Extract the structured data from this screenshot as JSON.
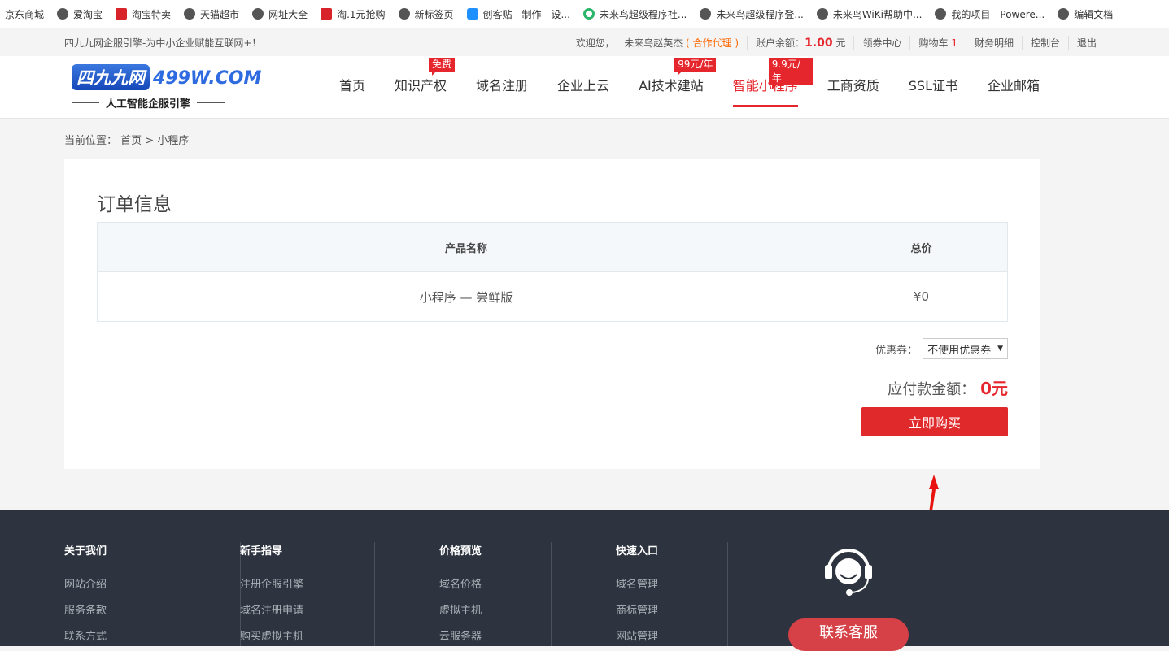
{
  "bookmarks": [
    {
      "label": "京东商城",
      "icon": "none"
    },
    {
      "label": "爱淘宝",
      "icon": "globe"
    },
    {
      "label": "淘宝特卖",
      "icon": "taobao"
    },
    {
      "label": "天猫超市",
      "icon": "globe"
    },
    {
      "label": "网址大全",
      "icon": "globe"
    },
    {
      "label": "淘.1元抢购",
      "icon": "taobao"
    },
    {
      "label": "新标签页",
      "icon": "globe"
    },
    {
      "label": "创客贴 - 制作 - 设...",
      "icon": "chuangke"
    },
    {
      "label": "未来鸟超级程序社...",
      "icon": "green"
    },
    {
      "label": "未来鸟超级程序登...",
      "icon": "globe"
    },
    {
      "label": "未来鸟WiKi帮助中...",
      "icon": "globe"
    },
    {
      "label": "我的项目 - Powere...",
      "icon": "globe"
    },
    {
      "label": "编辑文档",
      "icon": "globe"
    }
  ],
  "topbar": {
    "slogan": "四九九网企服引擎-为中小企业赋能互联网+！",
    "welcome": "欢迎您，",
    "user": "未来鸟赵英杰",
    "role": "( 合作代理 )",
    "balance_label": "账户余额：",
    "balance": "1.00",
    "balance_unit": "元",
    "links": [
      "领券中心",
      "购物车",
      "财务明细",
      "控制台",
      "退出"
    ],
    "cart_count": "1"
  },
  "logo": {
    "badge": "四九九网",
    "domain": "499W.COM",
    "sub": "人工智能企服引擎"
  },
  "nav": [
    {
      "label": "首页"
    },
    {
      "label": "知识产权",
      "tag": "免费"
    },
    {
      "label": "域名注册"
    },
    {
      "label": "企业上云"
    },
    {
      "label": "AI技术建站",
      "tag": "99元/年"
    },
    {
      "label": "智能小程序",
      "tag": "9.9元/年",
      "active": true
    },
    {
      "label": "工商资质"
    },
    {
      "label": "SSL证书"
    },
    {
      "label": "企业邮箱"
    }
  ],
  "breadcrumb": {
    "label": "当前位置：",
    "home": "首页",
    "sep": ">",
    "current": "小程序"
  },
  "order": {
    "title": "订单信息",
    "headers": [
      "产品名称",
      "总价"
    ],
    "rows": [
      [
        "小程序 — 尝鲜版",
        "¥0"
      ]
    ],
    "coupon_label": "优惠券：",
    "coupon_value": "不使用优惠券",
    "total_label": "应付款金额：",
    "total": "0元",
    "buy": "立即购买"
  },
  "footer": {
    "columns": [
      {
        "title": "关于我们",
        "links": [
          "网站介绍",
          "服务条款",
          "联系方式"
        ]
      },
      {
        "title": "新手指导",
        "links": [
          "注册企服引擎",
          "域名注册申请",
          "购买虚拟主机"
        ]
      },
      {
        "title": "价格预览",
        "links": [
          "域名价格",
          "虚拟主机",
          "云服务器"
        ]
      },
      {
        "title": "快速入口",
        "links": [
          "域名管理",
          "商标管理",
          "网站管理"
        ]
      }
    ],
    "service": "联系客服"
  },
  "colors": {
    "accent": "#e5262c",
    "footer_bg": "#2d343f"
  }
}
